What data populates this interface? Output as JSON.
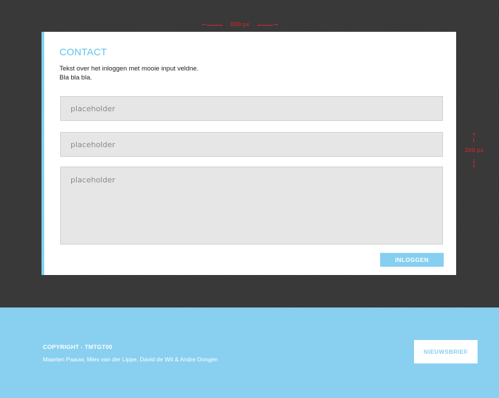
{
  "annotations": {
    "width_label": "800 px",
    "height_label": "200 px"
  },
  "contact": {
    "title": "CONTACT",
    "text_line1": "Tekst over het inloggen met mooie input veldne.",
    "text_line2": "Bla bla bla.",
    "field1_placeholder": "placeholder",
    "field2_placeholder": "placeholder",
    "field3_placeholder": "placeholder",
    "login_label": "INLOGGEN"
  },
  "footer": {
    "copyright": "COPYRIGHT - TMTGT00",
    "names": "Maarten Paauw, Mies van der Lippe, David de Wit & Andre Dongen",
    "newsletter_label": "NIEUWSBRIEF"
  },
  "colors": {
    "accent": "#86cff0",
    "title": "#5bc0ec",
    "background": "#383838",
    "annotation": "#e0262a"
  }
}
